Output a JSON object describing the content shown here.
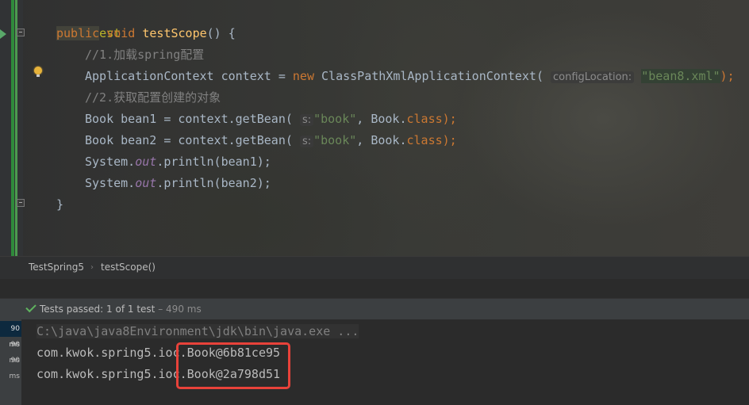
{
  "editor": {
    "lines": {
      "annotation": "@Test",
      "kw_public": "public",
      "kw_void": "void",
      "method_name": "testScope",
      "method_tail": "() {",
      "comment1": "//1.加载spring配置",
      "ctx_type": "ApplicationContext context = ",
      "kw_new": "new",
      "ctx_class": " ClassPathXmlApplicationContext(",
      "ctx_hint": "configLocation:",
      "ctx_string": "\"bean8.xml\"",
      "ctx_end": ");",
      "comment2": "//2.获取配置创建的对象",
      "book1_prefix": "Book bean1 = context.getBean(",
      "book2_prefix": "Book bean2 = context.getBean(",
      "param_hint": "s:",
      "book_string": "\"book\"",
      "book_mid": ", Book.",
      "kw_class": "class",
      "book_end": ");",
      "sys_prefix": "System.",
      "sys_out": "out",
      "print1_tail": ".println(bean1);",
      "print2_tail": ".println(bean2);",
      "close_brace": "}"
    }
  },
  "breadcrumb": {
    "items": [
      "TestSpring5",
      "testScope()"
    ],
    "separator": "›"
  },
  "run_panel": {
    "status_label": "Tests passed:",
    "status_count": "1",
    "status_of": "of 1 test",
    "status_dash": "–",
    "status_time": "490 ms",
    "tree_times": [
      "90 ms",
      "90 ms",
      "90 ms"
    ],
    "console_lines": [
      "C:\\java\\java8Environment\\jdk\\bin\\java.exe ...",
      "com.kwok.spring5.ioc.Book@6b81ce95",
      "com.kwok.spring5.ioc.Book@2a798d51"
    ]
  },
  "colors": {
    "keyword": "#cc7832",
    "annotation": "#bbb529",
    "string": "#6a8759",
    "method": "#ffc66d",
    "field": "#9876aa",
    "pass_green": "#5fb35f",
    "highlight_box": "#e8423a"
  },
  "icons": {
    "run": "run-test-icon",
    "intention": "lightbulb-icon",
    "pass": "check-icon"
  }
}
